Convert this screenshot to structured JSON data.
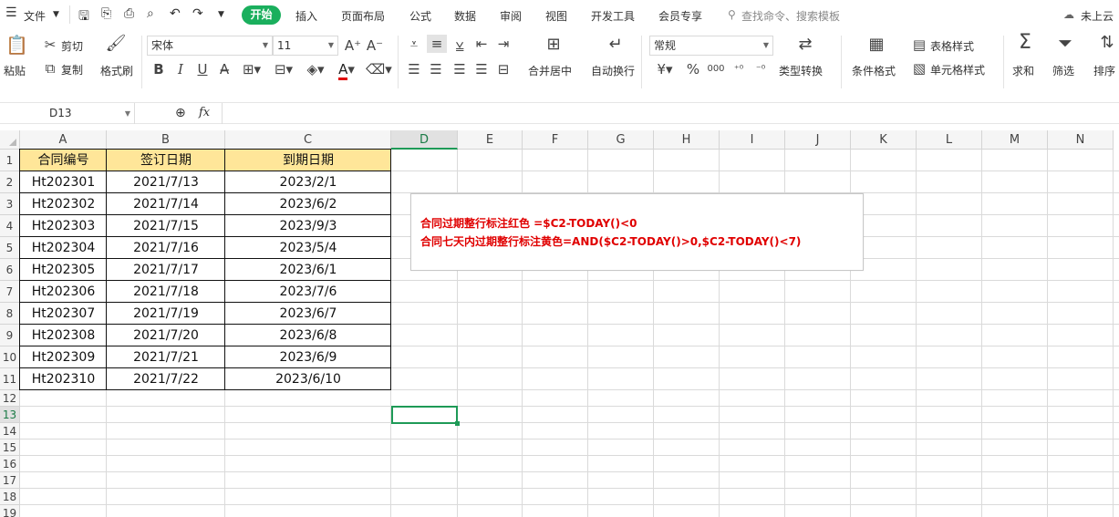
{
  "menu": {
    "file": "文件",
    "tabs": [
      "开始",
      "插入",
      "页面布局",
      "公式",
      "数据",
      "审阅",
      "视图",
      "开发工具",
      "会员专享"
    ],
    "search": "查找命令、搜索模板",
    "cloud": "未上云"
  },
  "ribbon": {
    "paste": "粘贴",
    "cut": "剪切",
    "copy": "复制",
    "format_painter": "格式刷",
    "font_name": "宋体",
    "font_size": "11",
    "merge_center": "合并居中",
    "wrap_text": "自动换行",
    "number_format": "常规",
    "type_convert": "类型转换",
    "cond_format": "条件格式",
    "table_style": "表格样式",
    "cell_style": "单元格样式",
    "sum": "求和",
    "filter": "筛选",
    "sort": "排序",
    "bold": "B",
    "italic": "I",
    "underline": "U",
    "font_color_letter": "A",
    "currency": "¥",
    "percent": "%",
    "thousands": "000"
  },
  "formula_bar": {
    "name_box": "D13",
    "fx": "fx",
    "content": ""
  },
  "columns": [
    "A",
    "B",
    "C",
    "D",
    "E",
    "F",
    "G",
    "H",
    "I",
    "J",
    "K",
    "L",
    "M",
    "N"
  ],
  "selected_column": "D",
  "rows": [
    "1",
    "2",
    "3",
    "4",
    "5",
    "6",
    "7",
    "8",
    "9",
    "10",
    "11",
    "12",
    "13",
    "14",
    "15",
    "16",
    "17",
    "18",
    "19"
  ],
  "selected_row": "13",
  "table": {
    "headers": [
      "合同编号",
      "签订日期",
      "到期日期"
    ],
    "data": [
      [
        "Ht202301",
        "2021/7/13",
        "2023/2/1"
      ],
      [
        "Ht202302",
        "2021/7/14",
        "2023/6/2"
      ],
      [
        "Ht202303",
        "2021/7/15",
        "2023/9/3"
      ],
      [
        "Ht202304",
        "2021/7/16",
        "2023/5/4"
      ],
      [
        "Ht202305",
        "2021/7/17",
        "2023/6/1"
      ],
      [
        "Ht202306",
        "2021/7/18",
        "2023/7/6"
      ],
      [
        "Ht202307",
        "2021/7/19",
        "2023/6/7"
      ],
      [
        "Ht202308",
        "2021/7/20",
        "2023/6/8"
      ],
      [
        "Ht202309",
        "2021/7/21",
        "2023/6/9"
      ],
      [
        "Ht202310",
        "2021/7/22",
        "2023/6/10"
      ]
    ]
  },
  "note": {
    "line1": "合同过期整行标注红色  =$C2-TODAY()<0",
    "line2": "合同七天内过期整行标注黄色=AND($C2-TODAY()>0,$C2-TODAY()<7)"
  },
  "colors": {
    "accent": "#1aaf5d",
    "header_fill": "#ffe699",
    "note_text": "#e00000"
  }
}
